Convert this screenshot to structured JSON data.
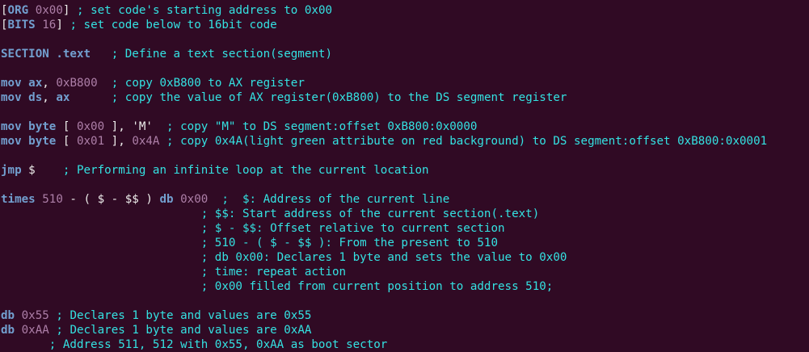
{
  "colors": {
    "background": "#300a24",
    "keyword": "#729fcf",
    "number": "#ad7fa8",
    "comment": "#34e2e2",
    "text": "#eeeeec"
  },
  "lines": [
    [
      {
        "t": "[",
        "c": "pl"
      },
      {
        "t": "ORG",
        "c": "kw"
      },
      {
        "t": " ",
        "c": "pl"
      },
      {
        "t": "0x00",
        "c": "num"
      },
      {
        "t": "] ",
        "c": "pl"
      },
      {
        "t": "; set code's starting address to 0x00",
        "c": "cm"
      }
    ],
    [
      {
        "t": "[",
        "c": "pl"
      },
      {
        "t": "BITS",
        "c": "kw"
      },
      {
        "t": " ",
        "c": "pl"
      },
      {
        "t": "16",
        "c": "num"
      },
      {
        "t": "] ",
        "c": "pl"
      },
      {
        "t": "; set code below to 16bit code",
        "c": "cm"
      }
    ],
    [],
    [
      {
        "t": "SECTION",
        "c": "kw"
      },
      {
        "t": " ",
        "c": "pl"
      },
      {
        "t": ".text",
        "c": "kw"
      },
      {
        "t": "   ",
        "c": "pl"
      },
      {
        "t": "; Define a text section(segment)",
        "c": "cm"
      }
    ],
    [],
    [
      {
        "t": "mov",
        "c": "kw"
      },
      {
        "t": " ",
        "c": "pl"
      },
      {
        "t": "ax",
        "c": "kw"
      },
      {
        "t": ", ",
        "c": "pl"
      },
      {
        "t": "0xB800",
        "c": "num"
      },
      {
        "t": "  ",
        "c": "pl"
      },
      {
        "t": "; copy 0xB800 to AX register",
        "c": "cm"
      }
    ],
    [
      {
        "t": "mov",
        "c": "kw"
      },
      {
        "t": " ",
        "c": "pl"
      },
      {
        "t": "ds",
        "c": "kw"
      },
      {
        "t": ", ",
        "c": "pl"
      },
      {
        "t": "ax",
        "c": "kw"
      },
      {
        "t": "      ",
        "c": "pl"
      },
      {
        "t": "; copy the value of AX register(0xB800) to the DS segment register",
        "c": "cm"
      }
    ],
    [],
    [
      {
        "t": "mov",
        "c": "kw"
      },
      {
        "t": " ",
        "c": "pl"
      },
      {
        "t": "byte",
        "c": "kw"
      },
      {
        "t": " [ ",
        "c": "pl"
      },
      {
        "t": "0x00",
        "c": "num"
      },
      {
        "t": " ], ",
        "c": "pl"
      },
      {
        "t": "'M'",
        "c": "str"
      },
      {
        "t": "  ",
        "c": "pl"
      },
      {
        "t": "; copy \"M\" to DS segment:offset 0xB800:0x0000",
        "c": "cm"
      }
    ],
    [
      {
        "t": "mov",
        "c": "kw"
      },
      {
        "t": " ",
        "c": "pl"
      },
      {
        "t": "byte",
        "c": "kw"
      },
      {
        "t": " [ ",
        "c": "pl"
      },
      {
        "t": "0x01",
        "c": "num"
      },
      {
        "t": " ], ",
        "c": "pl"
      },
      {
        "t": "0x4A",
        "c": "num"
      },
      {
        "t": " ",
        "c": "pl"
      },
      {
        "t": "; copy 0x4A(light green attribute on red background) to DS segment:offset 0xB800:0x0001",
        "c": "cm"
      }
    ],
    [],
    [
      {
        "t": "jmp",
        "c": "kw"
      },
      {
        "t": " $    ",
        "c": "pl"
      },
      {
        "t": "; Performing an infinite loop at the current location",
        "c": "cm"
      }
    ],
    [],
    [
      {
        "t": "times",
        "c": "kw"
      },
      {
        "t": " ",
        "c": "pl"
      },
      {
        "t": "510",
        "c": "num"
      },
      {
        "t": " - ( $ - $$ ) ",
        "c": "pl"
      },
      {
        "t": "db",
        "c": "kw"
      },
      {
        "t": " ",
        "c": "pl"
      },
      {
        "t": "0x00",
        "c": "num"
      },
      {
        "t": "  ",
        "c": "pl"
      },
      {
        "t": ";  $: Address of the current line",
        "c": "cm"
      }
    ],
    [
      {
        "t": "                             ",
        "c": "pl"
      },
      {
        "t": "; $$: Start address of the current section(.text)",
        "c": "cm"
      }
    ],
    [
      {
        "t": "                             ",
        "c": "pl"
      },
      {
        "t": "; $ - $$: Offset relative to current section",
        "c": "cm"
      }
    ],
    [
      {
        "t": "                             ",
        "c": "pl"
      },
      {
        "t": "; 510 - ( $ - $$ ): From the present to 510",
        "c": "cm"
      }
    ],
    [
      {
        "t": "                             ",
        "c": "pl"
      },
      {
        "t": "; db 0x00: Declares 1 byte and sets the value to 0x00",
        "c": "cm"
      }
    ],
    [
      {
        "t": "                             ",
        "c": "pl"
      },
      {
        "t": "; time: repeat action",
        "c": "cm"
      }
    ],
    [
      {
        "t": "                             ",
        "c": "pl"
      },
      {
        "t": "; 0x00 filled from current position to address 510;",
        "c": "cm"
      }
    ],
    [],
    [
      {
        "t": "db",
        "c": "kw"
      },
      {
        "t": " ",
        "c": "pl"
      },
      {
        "t": "0x55",
        "c": "num"
      },
      {
        "t": " ",
        "c": "pl"
      },
      {
        "t": "; Declares 1 byte and values are 0x55",
        "c": "cm"
      }
    ],
    [
      {
        "t": "db",
        "c": "kw"
      },
      {
        "t": " ",
        "c": "pl"
      },
      {
        "t": "0xAA",
        "c": "num"
      },
      {
        "t": " ",
        "c": "pl"
      },
      {
        "t": "; Declares 1 byte and values are 0xAA",
        "c": "cm"
      }
    ],
    [
      {
        "t": "       ",
        "c": "pl"
      },
      {
        "t": "; Address 511, 512 with 0x55, 0xAA as boot sector",
        "c": "cm"
      }
    ]
  ]
}
